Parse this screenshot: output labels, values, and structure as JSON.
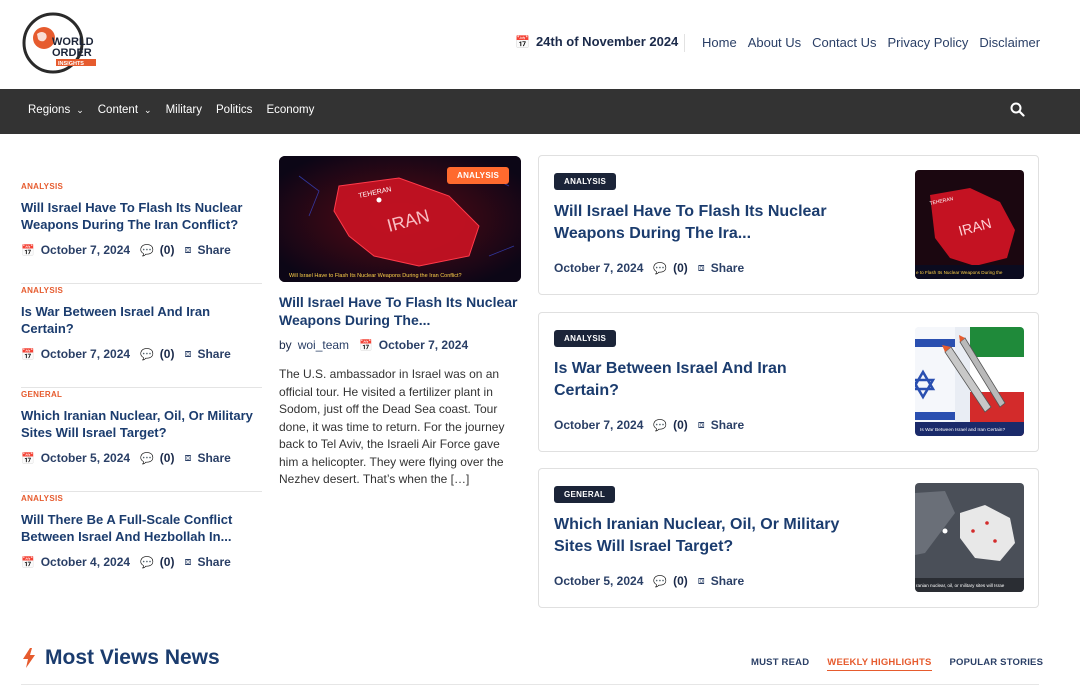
{
  "header": {
    "logo": {
      "line1": "WORLD",
      "line2": "ORDER",
      "line3": "INSIGHTS"
    },
    "date": "24th of November 2024",
    "links": [
      "Home",
      "About Us",
      "Contact Us",
      "Privacy Policy",
      "Disclaimer"
    ]
  },
  "nav": {
    "items": [
      "Regions",
      "Content",
      "Military",
      "Politics",
      "Economy"
    ]
  },
  "left_list": [
    {
      "category": "ANALYSIS",
      "title": "Will Israel Have To Flash Its Nuclear Weapons During The Iran Conflict?",
      "date": "October 7, 2024",
      "comments": "(0)",
      "share": "Share"
    },
    {
      "category": "ANALYSIS",
      "title": "Is War Between Israel And Iran Certain?",
      "date": "October 7, 2024",
      "comments": "(0)",
      "share": "Share"
    },
    {
      "category": "GENERAL",
      "title": "Which Iranian Nuclear, Oil, Or Military Sites Will Israel Target?",
      "date": "October 5, 2024",
      "comments": "(0)",
      "share": "Share"
    },
    {
      "category": "ANALYSIS",
      "title": "Will There Be A Full-Scale Conflict Between Israel And Hezbollah In...",
      "date": "October 4, 2024",
      "comments": "(0)",
      "share": "Share"
    }
  ],
  "featured": {
    "badge": "ANALYSIS",
    "image_caption": "Will Israel Have to Flash Its Nuclear Weapons During the Iran Conflict?",
    "image_text_country": "IRAN",
    "image_text_city": "TEHERAN",
    "title": "Will Israel Have To Flash Its Nuclear Weapons During The...",
    "by": "by",
    "author": "woi_team",
    "date": "October 7, 2024",
    "excerpt": "The U.S. ambassador in Israel was on an official tour. He visited a fertilizer plant in Sodom, just off the Dead Sea coast. Tour done, it was time to return. For the journey back to Tel Aviv, the Israeli Air Force gave him a helicopter. They were flying over the Nezhev desert. That’s when the […]"
  },
  "right_cards": [
    {
      "badge": "ANALYSIS",
      "title": "Will Israel Have To Flash Its Nuclear Weapons During The Ira...",
      "date": "October 7, 2024",
      "comments": "(0)",
      "share": "Share",
      "thumb_caption": "e to Flash Its Nuclear Weapons During the"
    },
    {
      "badge": "ANALYSIS",
      "title": "Is War Between Israel And Iran Certain?",
      "date": "October 7, 2024",
      "comments": "(0)",
      "share": "Share",
      "thumb_caption": "Is War Between Israel and Iran Certain?"
    },
    {
      "badge": "GENERAL",
      "title": "Which Iranian Nuclear, Oil, Or Military Sites Will Israel Target?",
      "date": "October 5, 2024",
      "comments": "(0)",
      "share": "Share",
      "thumb_caption": "ranian nuclear, oil, or military sites will Israe"
    }
  ],
  "most_views": {
    "title": "Most Views News",
    "tabs": [
      "MUST READ",
      "WEEKLY HIGHLIGHTS",
      "POPULAR STORIES"
    ],
    "active_tab": "WEEKLY HIGHLIGHTS"
  },
  "colors": {
    "accent": "#e65b2e",
    "navy": "#1b3c6e",
    "nav_bg": "#333333",
    "badge_dark": "#1b2438"
  }
}
